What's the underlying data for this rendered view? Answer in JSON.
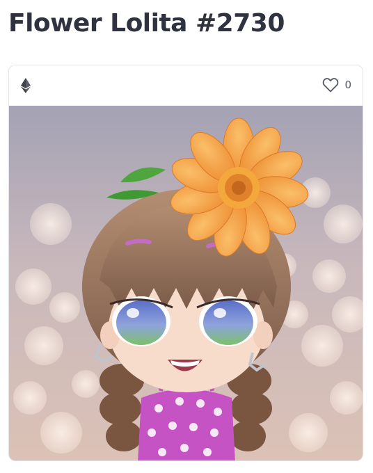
{
  "page": {
    "title": "Flower Lolita #2730"
  },
  "card": {
    "currency_icon": "ethereum-icon",
    "favorite_icon": "heart-outline-icon",
    "favorite_count": "0",
    "image_icon": "nft-artwork-chibi-girl-with-orange-flower"
  },
  "colors": {
    "title": "#2f3340",
    "border": "#e1e3e8",
    "flower": "#f39a3c",
    "dress": "#c653c4"
  }
}
